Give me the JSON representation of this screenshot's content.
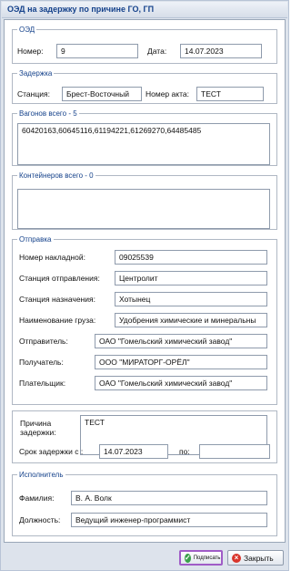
{
  "window": {
    "title": "ОЭД на задержку по причине ГО, ГП"
  },
  "oed": {
    "legend": "ОЭД",
    "number_label": "Номер:",
    "number_value": "9",
    "date_label": "Дата:",
    "date_value": "14.07.2023"
  },
  "delay": {
    "legend": "Задержка",
    "station_label": "Станция:",
    "station_value": "Брест-Восточный",
    "act_label": "Номер акта:",
    "act_value": "ТЕСТ"
  },
  "wagons": {
    "legend": "Вагонов всего - 5",
    "value": "60420163,60645116,61194221,61269270,64485485"
  },
  "containers": {
    "legend": "Контейнеров всего - 0",
    "value": ""
  },
  "shipment": {
    "legend": "Отправка",
    "fields": [
      {
        "label": "Номер накладной:",
        "value": "09025539"
      },
      {
        "label": "Станция отправления:",
        "value": "Центролит"
      },
      {
        "label": "Станция назначения:",
        "value": "Хотынец"
      },
      {
        "label": "Наименование груза:",
        "value": "Удобрения химические и минеральны"
      },
      {
        "label": "Отправитель:",
        "value": "ОАО \"Гомельский химический завод\""
      },
      {
        "label": "Получатель:",
        "value": "ООО \"МИРАТОРГ-ОРЁЛ\""
      },
      {
        "label": "Плательщик:",
        "value": "ОАО \"Гомельский химический завод\""
      }
    ]
  },
  "reason": {
    "label_line1": "Причина",
    "label_line2": "задержки:",
    "value": "ТЕСТ",
    "term_label": "Срок задержки с :",
    "term_from": "14.07.2023",
    "to_label": "по:",
    "term_to": ""
  },
  "executor": {
    "legend": "Исполнитель",
    "surname_label": "Фамилия:",
    "surname_value": "В. А. Волк",
    "position_label": "Должность:",
    "position_value": "Ведущий инженер-программист"
  },
  "buttons": {
    "sign_label": "Подписать",
    "close_label": "Закрыть"
  },
  "icons": {
    "sign": "check-icon",
    "close": "close-icon"
  },
  "colors": {
    "title_text": "#15428b",
    "sign_border": "#a05cc7",
    "check_green": "#3aa14a",
    "close_red": "#d9352b"
  }
}
